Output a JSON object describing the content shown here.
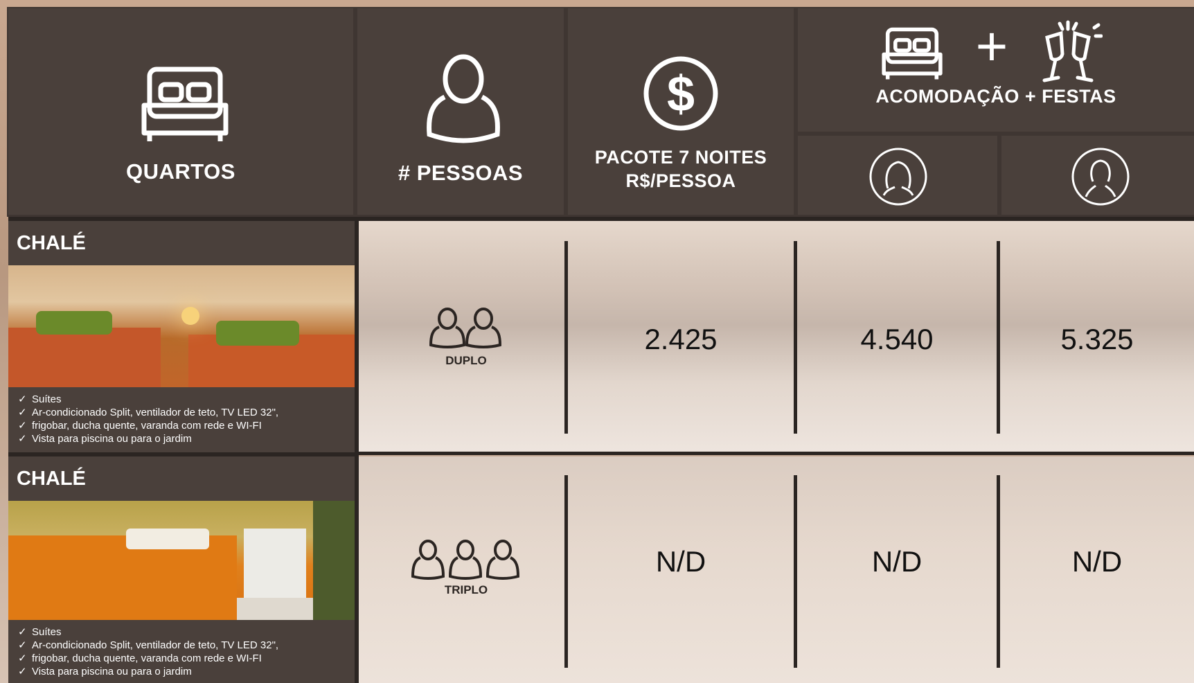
{
  "header": {
    "quartos": "QUARTOS",
    "pessoas": "# PESSOAS",
    "pacote_line1": "PACOTE 7 NOITES",
    "pacote_line2": "R$/PESSOA",
    "plus": "+",
    "acomodacao_festas": "ACOMODAÇÃO + FESTAS"
  },
  "rooms": [
    {
      "title": "CHALÉ",
      "features": [
        "Suítes",
        "Ar-condicionado Split, ventilador de teto, TV LED 32\",",
        "frigobar, ducha quente, varanda com rede e WI-FI",
        "Vista para piscina ou para o jardim"
      ],
      "occupancy": "DUPLO",
      "price_package": "2.425",
      "price_female": "4.540",
      "price_male": "5.325"
    },
    {
      "title": "CHALÉ",
      "features": [
        "Suítes",
        "Ar-condicionado Split, ventilador de teto, TV LED 32\",",
        "frigobar, ducha quente, varanda com rede e WI-FI",
        "Vista para piscina ou para o jardim"
      ],
      "occupancy": "TRIPLO",
      "price_package": "N/D",
      "price_female": "N/D",
      "price_male": "N/D"
    }
  ],
  "icons": {
    "quartos": "bed-icon",
    "pessoas": "person-icon",
    "pacote": "dollar-icon",
    "acomodacao": "bed-icon",
    "festas": "champagne-icon",
    "female": "female-icon",
    "male": "male-icon",
    "duplo": "two-people-icon",
    "triplo": "three-people-icon"
  },
  "colors": {
    "header_bg": "#4a403b",
    "separator": "#2b2522",
    "price_text": "#111111"
  }
}
